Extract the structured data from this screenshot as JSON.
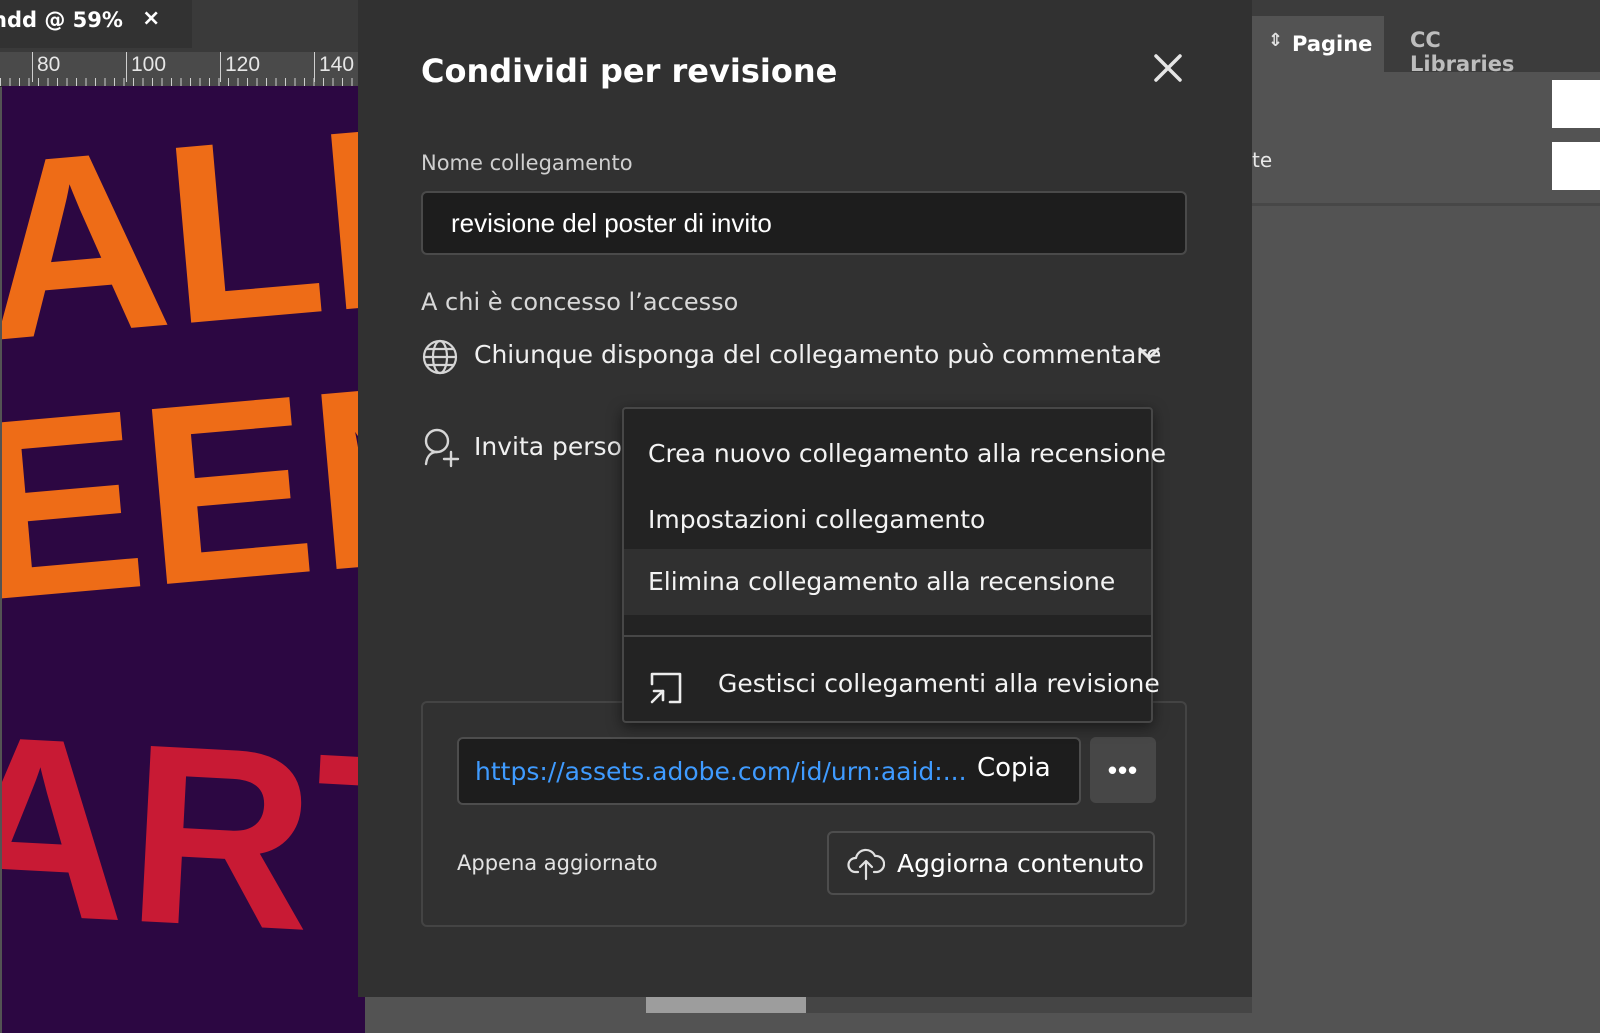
{
  "document": {
    "tab_title": "ndd @ 59%",
    "tab_close": "×",
    "ruler_labels": [
      "80",
      "100",
      "120",
      "140"
    ],
    "poster_lines": [
      "ALLO",
      "EEN",
      "ARTY"
    ]
  },
  "panel": {
    "tabs": [
      {
        "label": "Pagine",
        "active": true
      },
      {
        "label": "CC Libraries",
        "active": false
      }
    ],
    "row_text": "te"
  },
  "dialog": {
    "title": "Condividi per revisione",
    "link_name_label": "Nome collegamento",
    "link_name_value": "revisione del poster di invito",
    "access_label": "A chi è concesso l’accesso",
    "access_value": "Chiunque disponga del collegamento può commentare",
    "invite_label": "Invita person",
    "link_url": "https://assets.adobe.com/id/urn:aaid:...",
    "copy_label": "Copia",
    "more_label": "•••",
    "updated_text": "Appena aggiornato",
    "update_button_label": "Aggiorna contenuto"
  },
  "context_menu": {
    "items": [
      {
        "label": "Crea nuovo collegamento alla recensione"
      },
      {
        "label": "Impostazioni collegamento"
      },
      {
        "label": "Elimina collegamento alla recensione",
        "highlighted": true
      },
      {
        "label": "Gestisci collegamenti alla revisione",
        "icon": "external-link-icon"
      }
    ]
  },
  "colors": {
    "accent_link": "#3f9bff",
    "dialog_bg": "#313131",
    "poster_bg": "#2c0742",
    "poster_orange": "#ee6c17",
    "poster_red": "#c81a34"
  }
}
